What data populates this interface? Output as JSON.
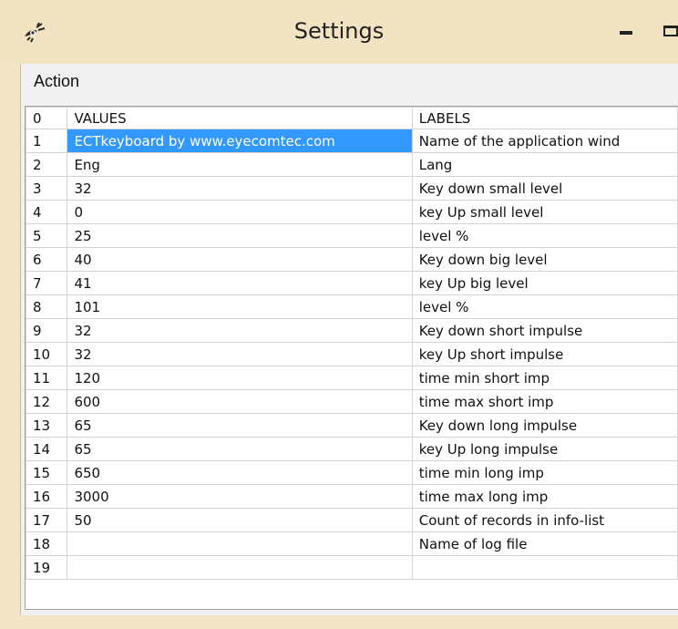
{
  "window": {
    "title": "Settings"
  },
  "menu": {
    "items": [
      "Action"
    ]
  },
  "table": {
    "header": {
      "index": "0",
      "values": "VALUES",
      "labels": "LABELS"
    },
    "rows": [
      {
        "index": "1",
        "value": "ECTkeyboard by www.eyecomtec.com",
        "label": "Name of the application wind"
      },
      {
        "index": "2",
        "value": "Eng",
        "label": "Lang"
      },
      {
        "index": "3",
        "value": "32",
        "label": "Key down small level"
      },
      {
        "index": "4",
        "value": "0",
        "label": "key Up small level"
      },
      {
        "index": "5",
        "value": "25",
        "label": "level %"
      },
      {
        "index": "6",
        "value": "40",
        "label": "Key down big level"
      },
      {
        "index": "7",
        "value": "41",
        "label": "key Up big  level"
      },
      {
        "index": "8",
        "value": "101",
        "label": "level %"
      },
      {
        "index": "9",
        "value": "32",
        "label": "Key down short impulse"
      },
      {
        "index": "10",
        "value": "32",
        "label": "key Up short impulse"
      },
      {
        "index": "11",
        "value": "120",
        "label": "time min short imp"
      },
      {
        "index": "12",
        "value": "600",
        "label": "time max short imp"
      },
      {
        "index": "13",
        "value": "65",
        "label": "Key down long impulse"
      },
      {
        "index": "14",
        "value": "65",
        "label": "key Up long impulse"
      },
      {
        "index": "15",
        "value": "650",
        "label": "time min long imp"
      },
      {
        "index": "16",
        "value": "3000",
        "label": "time max long imp"
      },
      {
        "index": "17",
        "value": "50",
        "label": "Count of records in info-list"
      },
      {
        "index": "18",
        "value": "",
        "label": "Name of log file"
      },
      {
        "index": "19",
        "value": "",
        "label": ""
      }
    ]
  },
  "icons": {
    "app": "eye-app-icon",
    "minimize": "minimize-icon",
    "maximize": "maximize-icon"
  },
  "colors": {
    "titlebar": "#f2e4c2",
    "selection": "#3399ff"
  }
}
